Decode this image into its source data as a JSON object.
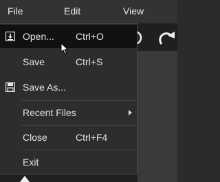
{
  "menubar": {
    "items": [
      {
        "label": "File"
      },
      {
        "label": "Edit"
      },
      {
        "label": "View"
      }
    ]
  },
  "toolbar": {
    "icons": [
      "circle-icon",
      "redo-icon"
    ]
  },
  "file_menu": {
    "items": [
      {
        "label": "Open...",
        "shortcut": "Ctrl+O",
        "icon": "open-file-icon",
        "highlighted": true
      },
      {
        "label": "Save",
        "shortcut": "Ctrl+S"
      },
      {
        "label": "Save As...",
        "icon": "floppy-disk-icon"
      },
      {
        "label": "Recent Files",
        "submenu": true
      },
      {
        "label": "Close",
        "shortcut": "Ctrl+F4"
      },
      {
        "label": "Exit"
      }
    ]
  },
  "colors": {
    "menu_bg": "#2d2d2d",
    "highlight": "#111111",
    "text": "#e4e4e4"
  }
}
